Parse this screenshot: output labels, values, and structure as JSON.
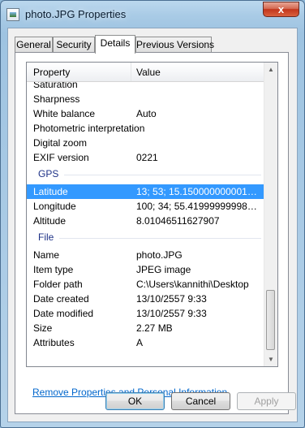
{
  "window": {
    "title": "photo.JPG Properties",
    "close_glyph": "x",
    "title_icon": "image-file-icon"
  },
  "tabs": [
    {
      "label": "General"
    },
    {
      "label": "Security"
    },
    {
      "label": "Details"
    },
    {
      "label": "Previous Versions"
    }
  ],
  "active_tab": "Details",
  "table": {
    "headers": {
      "property": "Property",
      "value": "Value"
    },
    "rows_before": [
      {
        "property": "Saturation",
        "value": ""
      },
      {
        "property": "Sharpness",
        "value": ""
      },
      {
        "property": "White balance",
        "value": "Auto"
      },
      {
        "property": "Photometric interpretation",
        "value": ""
      },
      {
        "property": "Digital zoom",
        "value": ""
      },
      {
        "property": "EXIF version",
        "value": "0221"
      }
    ],
    "group_gps": "GPS",
    "gps_rows": [
      {
        "property": "Latitude",
        "value": "13; 53; 15.1500000000015..."
      },
      {
        "property": "Longitude",
        "value": "100; 34; 55.419999999983..."
      },
      {
        "property": "Altitude",
        "value": "8.01046511627907"
      }
    ],
    "group_file": "File",
    "file_rows": [
      {
        "property": "Name",
        "value": "photo.JPG"
      },
      {
        "property": "Item type",
        "value": "JPEG image"
      },
      {
        "property": "Folder path",
        "value": "C:\\Users\\kannithi\\Desktop"
      },
      {
        "property": "Date created",
        "value": "13/10/2557 9:33"
      },
      {
        "property": "Date modified",
        "value": "13/10/2557 9:33"
      },
      {
        "property": "Size",
        "value": "2.27 MB"
      },
      {
        "property": "Attributes",
        "value": "A"
      }
    ],
    "selected_row": "Latitude"
  },
  "link": {
    "remove_properties": "Remove Properties and Personal Information"
  },
  "buttons": {
    "ok": "OK",
    "cancel": "Cancel",
    "apply": "Apply"
  },
  "colors": {
    "selection": "#3399ff",
    "group_header": "#1e3287",
    "link": "#0066cc"
  }
}
